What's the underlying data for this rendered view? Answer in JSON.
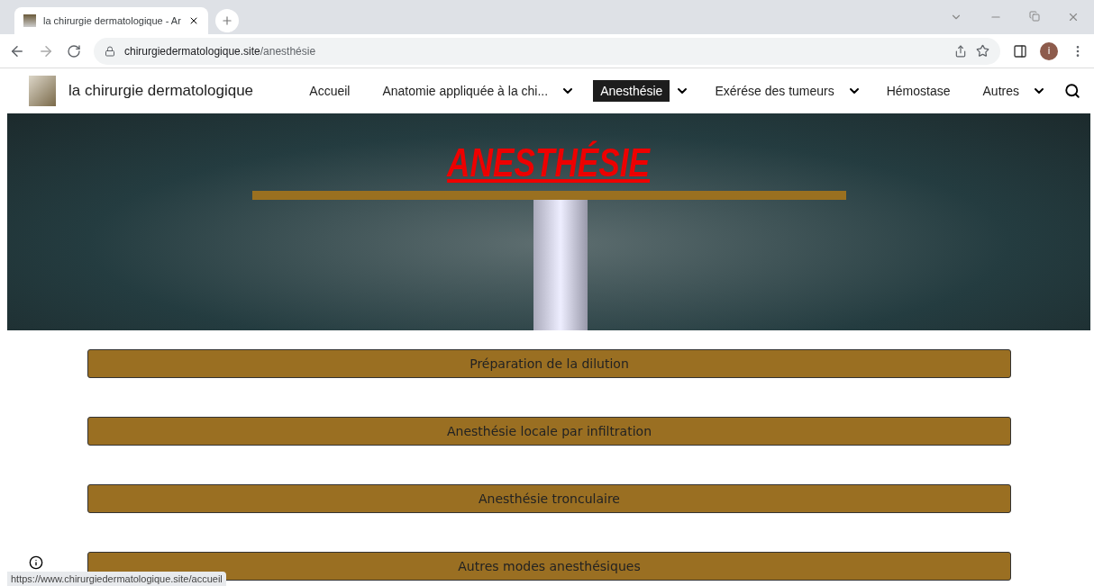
{
  "browser": {
    "tab": {
      "title": "la chirurgie dermatologique - Ar"
    },
    "url": {
      "domain": "chirurgiedermatologique.site",
      "path": "/anesthésie"
    },
    "profile": "i"
  },
  "site": {
    "title": "la chirurgie dermatologique",
    "nav": [
      {
        "label": "Accueil",
        "selected": false,
        "dropdown": false
      },
      {
        "label": "Anatomie appliquée à la chi...",
        "selected": false,
        "dropdown": true
      },
      {
        "label": "Anesthésie",
        "selected": true,
        "dropdown": true
      },
      {
        "label": "Exérése des tumeurs",
        "selected": false,
        "dropdown": true
      },
      {
        "label": "Hémostase",
        "selected": false,
        "dropdown": false
      },
      {
        "label": "Autres",
        "selected": false,
        "dropdown": true
      }
    ]
  },
  "hero": {
    "title": "ANESTHÉSIE"
  },
  "sections": [
    "Préparation de la dilution",
    "Anesthésie locale par infiltration",
    "Anesthésie tronculaire",
    "Autres modes anesthésiques"
  ],
  "status_bar": "https://www.chirurgiedermatologique.site/accueil"
}
